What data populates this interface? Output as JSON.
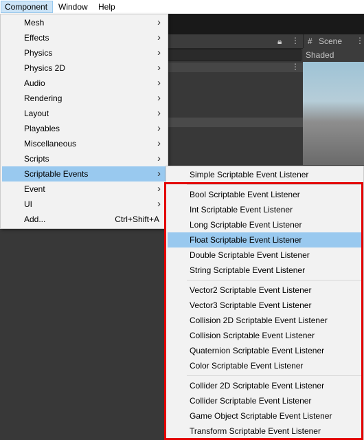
{
  "menubar": {
    "items": [
      {
        "label": "Component",
        "active": true
      },
      {
        "label": "Window",
        "active": false
      },
      {
        "label": "Help",
        "active": false
      }
    ]
  },
  "scene": {
    "tab_label": "Scene",
    "tab_icon": "hash-grid-icon",
    "shading_label": "Shaded"
  },
  "component_menu": {
    "items": [
      {
        "label": "Mesh",
        "submenu": true,
        "highlighted": false
      },
      {
        "label": "Effects",
        "submenu": true,
        "highlighted": false
      },
      {
        "label": "Physics",
        "submenu": true,
        "highlighted": false
      },
      {
        "label": "Physics 2D",
        "submenu": true,
        "highlighted": false
      },
      {
        "label": "Audio",
        "submenu": true,
        "highlighted": false
      },
      {
        "label": "Rendering",
        "submenu": true,
        "highlighted": false
      },
      {
        "label": "Layout",
        "submenu": true,
        "highlighted": false
      },
      {
        "label": "Playables",
        "submenu": true,
        "highlighted": false
      },
      {
        "label": "Miscellaneous",
        "submenu": true,
        "highlighted": false
      },
      {
        "label": "Scripts",
        "submenu": true,
        "highlighted": false
      },
      {
        "label": "Scriptable Events",
        "submenu": true,
        "highlighted": true
      },
      {
        "label": "Event",
        "submenu": true,
        "highlighted": false
      },
      {
        "label": "UI",
        "submenu": true,
        "highlighted": false
      },
      {
        "label": "Add...",
        "submenu": false,
        "highlighted": false,
        "shortcut": "Ctrl+Shift+A"
      }
    ]
  },
  "scriptable_events_menu": {
    "groups": [
      [
        "Simple Scriptable Event Listener"
      ],
      [
        "Bool Scriptable Event Listener",
        "Int Scriptable Event Listener",
        "Long Scriptable Event Listener",
        "Float Scriptable Event Listener",
        "Double Scriptable Event Listener",
        "String Scriptable Event Listener"
      ],
      [
        "Vector2 Scriptable Event Listener",
        "Vector3 Scriptable Event Listener",
        "Collision 2D Scriptable Event Listener",
        "Collision Scriptable Event Listener",
        "Quaternion Scriptable Event Listener",
        "Color Scriptable Event Listener"
      ],
      [
        "Collider 2D Scriptable Event Listener",
        "Collider Scriptable Event Listener",
        "Game Object Scriptable Event Listener",
        "Transform Scriptable Event Listener"
      ]
    ],
    "highlighted": "Float Scriptable Event Listener"
  },
  "colors": {
    "highlight": "#99c9ef",
    "menubar_active": "#cce4f7",
    "annotation_box": "#e30000"
  }
}
